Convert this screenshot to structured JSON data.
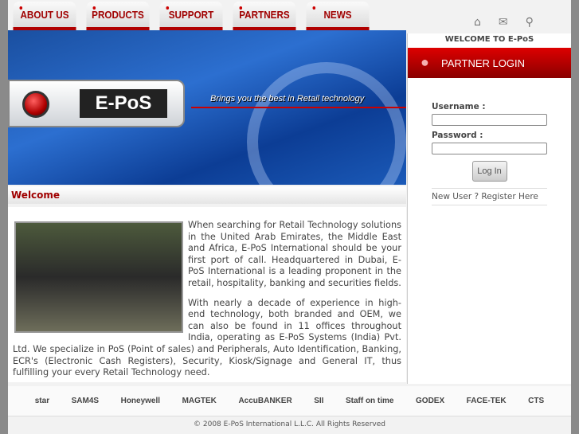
{
  "nav": [
    "ABOUT US",
    "PRODUCTS",
    "SUPPORT",
    "PARTNERS",
    "NEWS"
  ],
  "icons": [
    "home-icon",
    "mail-icon",
    "search-icon"
  ],
  "banner": {
    "logo_text": "E-PoS",
    "tagline": "Brings you the best in Retail technology"
  },
  "welcome_heading": "Welcome",
  "content": {
    "p1": "When searching for Retail Technology solutions in the United Arab Emirates, the Middle East and Africa, E-PoS International should be your first port of call. Headquartered in Dubai, E-PoS International is a leading proponent in the retail, hospitality, banking and securities fields.",
    "p2": "With nearly a decade of experience in high-end technology, both branded and OEM, we can also be found in 11 offices throughout India, operating as E-PoS Systems (India) Pvt. Ltd. We specialize in PoS (Point of sales) and Peripherals, Auto Identification, Banking, ECR's (Electronic Cash Registers), Security, Kiosk/Signage and General IT, thus fulfilling your every Retail Technology need."
  },
  "sidebar": {
    "welcome": "WELCOME TO E-PoS",
    "partner_login": "PARTNER LOGIN",
    "username_label": "Username :",
    "password_label": "Password :",
    "login_button": "Log In",
    "new_user": "New User ?  Register Here"
  },
  "partners": [
    "star",
    "SAM4S",
    "Honeywell",
    "MAGTEK",
    "AccuBANKER",
    "SII",
    "Staff on time",
    "GODEX",
    "FACE-TEK",
    "CTS"
  ],
  "footer": "© 2008 E-PoS International L.L.C. All Rights Reserved"
}
